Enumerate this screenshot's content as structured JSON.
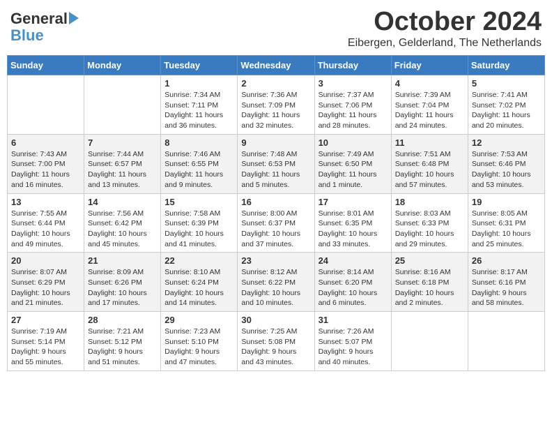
{
  "header": {
    "logo_line1": "General",
    "logo_line2": "Blue",
    "month": "October 2024",
    "location": "Eibergen, Gelderland, The Netherlands"
  },
  "days_of_week": [
    "Sunday",
    "Monday",
    "Tuesday",
    "Wednesday",
    "Thursday",
    "Friday",
    "Saturday"
  ],
  "weeks": [
    [
      {
        "num": "",
        "detail": ""
      },
      {
        "num": "",
        "detail": ""
      },
      {
        "num": "1",
        "detail": "Sunrise: 7:34 AM\nSunset: 7:11 PM\nDaylight: 11 hours\nand 36 minutes."
      },
      {
        "num": "2",
        "detail": "Sunrise: 7:36 AM\nSunset: 7:09 PM\nDaylight: 11 hours\nand 32 minutes."
      },
      {
        "num": "3",
        "detail": "Sunrise: 7:37 AM\nSunset: 7:06 PM\nDaylight: 11 hours\nand 28 minutes."
      },
      {
        "num": "4",
        "detail": "Sunrise: 7:39 AM\nSunset: 7:04 PM\nDaylight: 11 hours\nand 24 minutes."
      },
      {
        "num": "5",
        "detail": "Sunrise: 7:41 AM\nSunset: 7:02 PM\nDaylight: 11 hours\nand 20 minutes."
      }
    ],
    [
      {
        "num": "6",
        "detail": "Sunrise: 7:43 AM\nSunset: 7:00 PM\nDaylight: 11 hours\nand 16 minutes."
      },
      {
        "num": "7",
        "detail": "Sunrise: 7:44 AM\nSunset: 6:57 PM\nDaylight: 11 hours\nand 13 minutes."
      },
      {
        "num": "8",
        "detail": "Sunrise: 7:46 AM\nSunset: 6:55 PM\nDaylight: 11 hours\nand 9 minutes."
      },
      {
        "num": "9",
        "detail": "Sunrise: 7:48 AM\nSunset: 6:53 PM\nDaylight: 11 hours\nand 5 minutes."
      },
      {
        "num": "10",
        "detail": "Sunrise: 7:49 AM\nSunset: 6:50 PM\nDaylight: 11 hours\nand 1 minute."
      },
      {
        "num": "11",
        "detail": "Sunrise: 7:51 AM\nSunset: 6:48 PM\nDaylight: 10 hours\nand 57 minutes."
      },
      {
        "num": "12",
        "detail": "Sunrise: 7:53 AM\nSunset: 6:46 PM\nDaylight: 10 hours\nand 53 minutes."
      }
    ],
    [
      {
        "num": "13",
        "detail": "Sunrise: 7:55 AM\nSunset: 6:44 PM\nDaylight: 10 hours\nand 49 minutes."
      },
      {
        "num": "14",
        "detail": "Sunrise: 7:56 AM\nSunset: 6:42 PM\nDaylight: 10 hours\nand 45 minutes."
      },
      {
        "num": "15",
        "detail": "Sunrise: 7:58 AM\nSunset: 6:39 PM\nDaylight: 10 hours\nand 41 minutes."
      },
      {
        "num": "16",
        "detail": "Sunrise: 8:00 AM\nSunset: 6:37 PM\nDaylight: 10 hours\nand 37 minutes."
      },
      {
        "num": "17",
        "detail": "Sunrise: 8:01 AM\nSunset: 6:35 PM\nDaylight: 10 hours\nand 33 minutes."
      },
      {
        "num": "18",
        "detail": "Sunrise: 8:03 AM\nSunset: 6:33 PM\nDaylight: 10 hours\nand 29 minutes."
      },
      {
        "num": "19",
        "detail": "Sunrise: 8:05 AM\nSunset: 6:31 PM\nDaylight: 10 hours\nand 25 minutes."
      }
    ],
    [
      {
        "num": "20",
        "detail": "Sunrise: 8:07 AM\nSunset: 6:29 PM\nDaylight: 10 hours\nand 21 minutes."
      },
      {
        "num": "21",
        "detail": "Sunrise: 8:09 AM\nSunset: 6:26 PM\nDaylight: 10 hours\nand 17 minutes."
      },
      {
        "num": "22",
        "detail": "Sunrise: 8:10 AM\nSunset: 6:24 PM\nDaylight: 10 hours\nand 14 minutes."
      },
      {
        "num": "23",
        "detail": "Sunrise: 8:12 AM\nSunset: 6:22 PM\nDaylight: 10 hours\nand 10 minutes."
      },
      {
        "num": "24",
        "detail": "Sunrise: 8:14 AM\nSunset: 6:20 PM\nDaylight: 10 hours\nand 6 minutes."
      },
      {
        "num": "25",
        "detail": "Sunrise: 8:16 AM\nSunset: 6:18 PM\nDaylight: 10 hours\nand 2 minutes."
      },
      {
        "num": "26",
        "detail": "Sunrise: 8:17 AM\nSunset: 6:16 PM\nDaylight: 9 hours\nand 58 minutes."
      }
    ],
    [
      {
        "num": "27",
        "detail": "Sunrise: 7:19 AM\nSunset: 5:14 PM\nDaylight: 9 hours\nand 55 minutes."
      },
      {
        "num": "28",
        "detail": "Sunrise: 7:21 AM\nSunset: 5:12 PM\nDaylight: 9 hours\nand 51 minutes."
      },
      {
        "num": "29",
        "detail": "Sunrise: 7:23 AM\nSunset: 5:10 PM\nDaylight: 9 hours\nand 47 minutes."
      },
      {
        "num": "30",
        "detail": "Sunrise: 7:25 AM\nSunset: 5:08 PM\nDaylight: 9 hours\nand 43 minutes."
      },
      {
        "num": "31",
        "detail": "Sunrise: 7:26 AM\nSunset: 5:07 PM\nDaylight: 9 hours\nand 40 minutes."
      },
      {
        "num": "",
        "detail": ""
      },
      {
        "num": "",
        "detail": ""
      }
    ]
  ]
}
